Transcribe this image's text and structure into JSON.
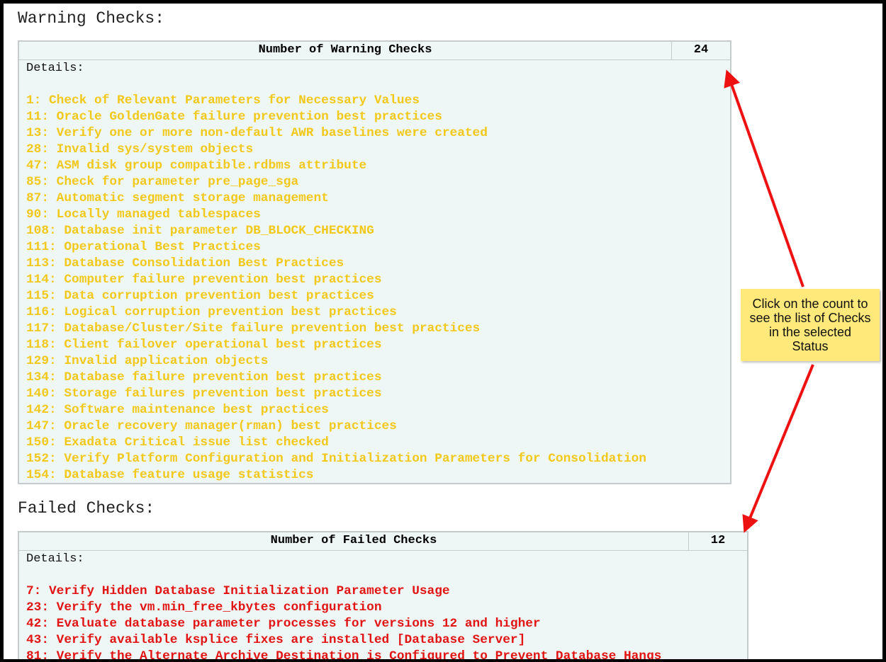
{
  "warning": {
    "title": "Warning Checks:",
    "header_label": "Number of Warning Checks",
    "count": "24",
    "details_label": "Details:",
    "items": [
      "1: Check of Relevant Parameters for Necessary Values",
      "11: Oracle GoldenGate failure prevention best practices",
      "13: Verify one or more non-default AWR baselines were created",
      "28: Invalid sys/system objects",
      "47: ASM disk group compatible.rdbms attribute",
      "85: Check for parameter pre_page_sga",
      "87: Automatic segment storage management",
      "90: Locally managed tablespaces",
      "108: Database init parameter DB_BLOCK_CHECKING",
      "111: Operational Best Practices",
      "113: Database Consolidation Best Practices",
      "114: Computer failure prevention best practices",
      "115: Data corruption prevention best practices",
      "116: Logical corruption prevention best practices",
      "117: Database/Cluster/Site failure prevention best practices",
      "118: Client failover operational best practices",
      "129: Invalid application objects",
      "134: Database failure prevention best practices",
      "140: Storage failures prevention best practices",
      "142: Software maintenance best practices",
      "147: Oracle recovery manager(rman) best practices",
      "150: Exadata Critical issue list checked",
      "152: Verify Platform Configuration and Initialization Parameters for Consolidation",
      "154: Database feature usage statistics"
    ],
    "item_color": "#f2c81a"
  },
  "failed": {
    "title": "Failed Checks:",
    "header_label": "Number of Failed Checks",
    "count": "12",
    "details_label": "Details:",
    "items": [
      "7: Verify Hidden Database Initialization Parameter Usage",
      "23: Verify the vm.min_free_kbytes configuration",
      "42: Evaluate database parameter processes for versions 12 and higher",
      "43: Verify available ksplice fixes are installed [Database Server]",
      "81: Verify the Alternate Archive Destination is Configured to Prevent Database Hangs"
    ],
    "item_color": "#e21414"
  },
  "callout": {
    "text": "Click on the count to see the list of Checks in the selected Status",
    "background": "#ffe97a",
    "arrow_color": "#ee1111"
  }
}
